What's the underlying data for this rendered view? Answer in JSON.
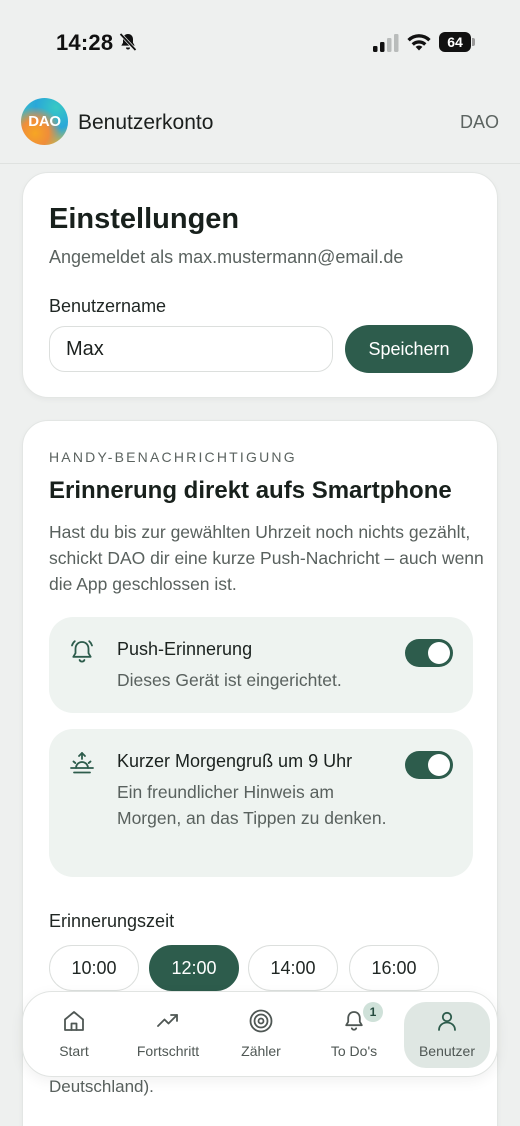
{
  "status_bar": {
    "time": "14:28",
    "battery": "64"
  },
  "app_bar": {
    "logo_text": "DAO",
    "title": "Benutzerkonto",
    "right_label": "DAO"
  },
  "settings": {
    "title": "Einstellungen",
    "signed_in": "Angemeldet als max.mustermann@email.de",
    "username_label": "Benutzername",
    "username_value": "Max",
    "save_label": "Speichern"
  },
  "notifications": {
    "eyebrow": "HANDY-BENACHRICHTIGUNG",
    "heading": "Erinnerung direkt aufs Smartphone",
    "description": "Hast du bis zur gewählten Uhrzeit noch nichts gezählt, schickt DAO dir eine kurze Push-Nachricht – auch wenn die App geschlossen ist.",
    "options": [
      {
        "title": "Push-Erinnerung",
        "subtitle": "Dieses Gerät ist eingerichtet.",
        "enabled": true,
        "icon": "bell-ring-icon"
      },
      {
        "title": "Kurzer Morgengruß um 9 Uhr",
        "subtitle": "Ein freundlicher Hinweis am Morgen, an das Tippen zu denken.",
        "enabled": true,
        "icon": "sunrise-icon"
      }
    ],
    "time_label": "Erinnerungszeit",
    "times": [
      "10:00",
      "12:00",
      "14:00",
      "16:00"
    ],
    "selected_time": "12:00",
    "footnote": "Deutschland)."
  },
  "bottom_nav": {
    "items": [
      {
        "label": "Start",
        "icon": "home-icon"
      },
      {
        "label": "Fortschritt",
        "icon": "trend-up-icon"
      },
      {
        "label": "Zähler",
        "icon": "target-icon"
      },
      {
        "label": "To Do's",
        "icon": "bell-icon",
        "badge": "1"
      },
      {
        "label": "Benutzer",
        "icon": "user-icon"
      }
    ],
    "active": "Benutzer"
  },
  "colors": {
    "accent": "#2d5c4c",
    "background": "#eef0ef",
    "option_bg": "#eef3f0"
  }
}
